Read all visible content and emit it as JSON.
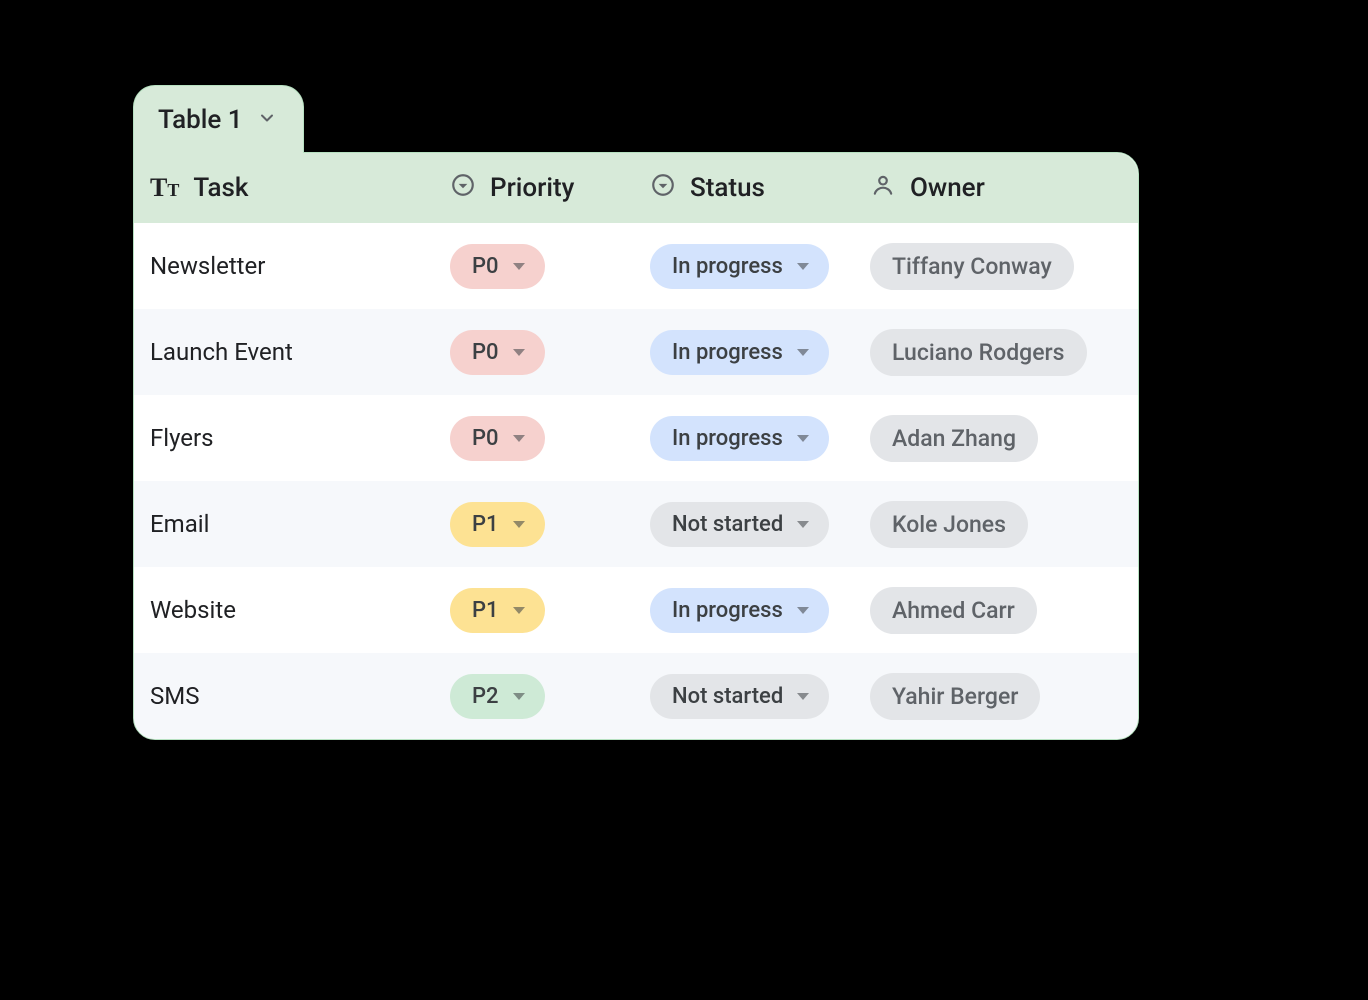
{
  "tab": {
    "label": "Table 1"
  },
  "columns": {
    "task": {
      "label": "Task"
    },
    "priority": {
      "label": "Priority"
    },
    "status": {
      "label": "Status"
    },
    "owner": {
      "label": "Owner"
    }
  },
  "priority_colors": {
    "P0": "#f6d1ce",
    "P1": "#fde293",
    "P2": "#ceead6"
  },
  "status_colors": {
    "In progress": "#d3e3fd",
    "Not started": "#e3e5e8"
  },
  "rows": [
    {
      "task": "Newsletter",
      "priority": "P0",
      "status": "In progress",
      "owner": "Tiffany Conway"
    },
    {
      "task": "Launch Event",
      "priority": "P0",
      "status": "In progress",
      "owner": "Luciano Rodgers"
    },
    {
      "task": "Flyers",
      "priority": "P0",
      "status": "In progress",
      "owner": "Adan Zhang"
    },
    {
      "task": "Email",
      "priority": "P1",
      "status": "Not started",
      "owner": "Kole Jones"
    },
    {
      "task": "Website",
      "priority": "P1",
      "status": "In progress",
      "owner": "Ahmed Carr"
    },
    {
      "task": "SMS",
      "priority": "P2",
      "status": "Not started",
      "owner": "Yahir Berger"
    }
  ]
}
